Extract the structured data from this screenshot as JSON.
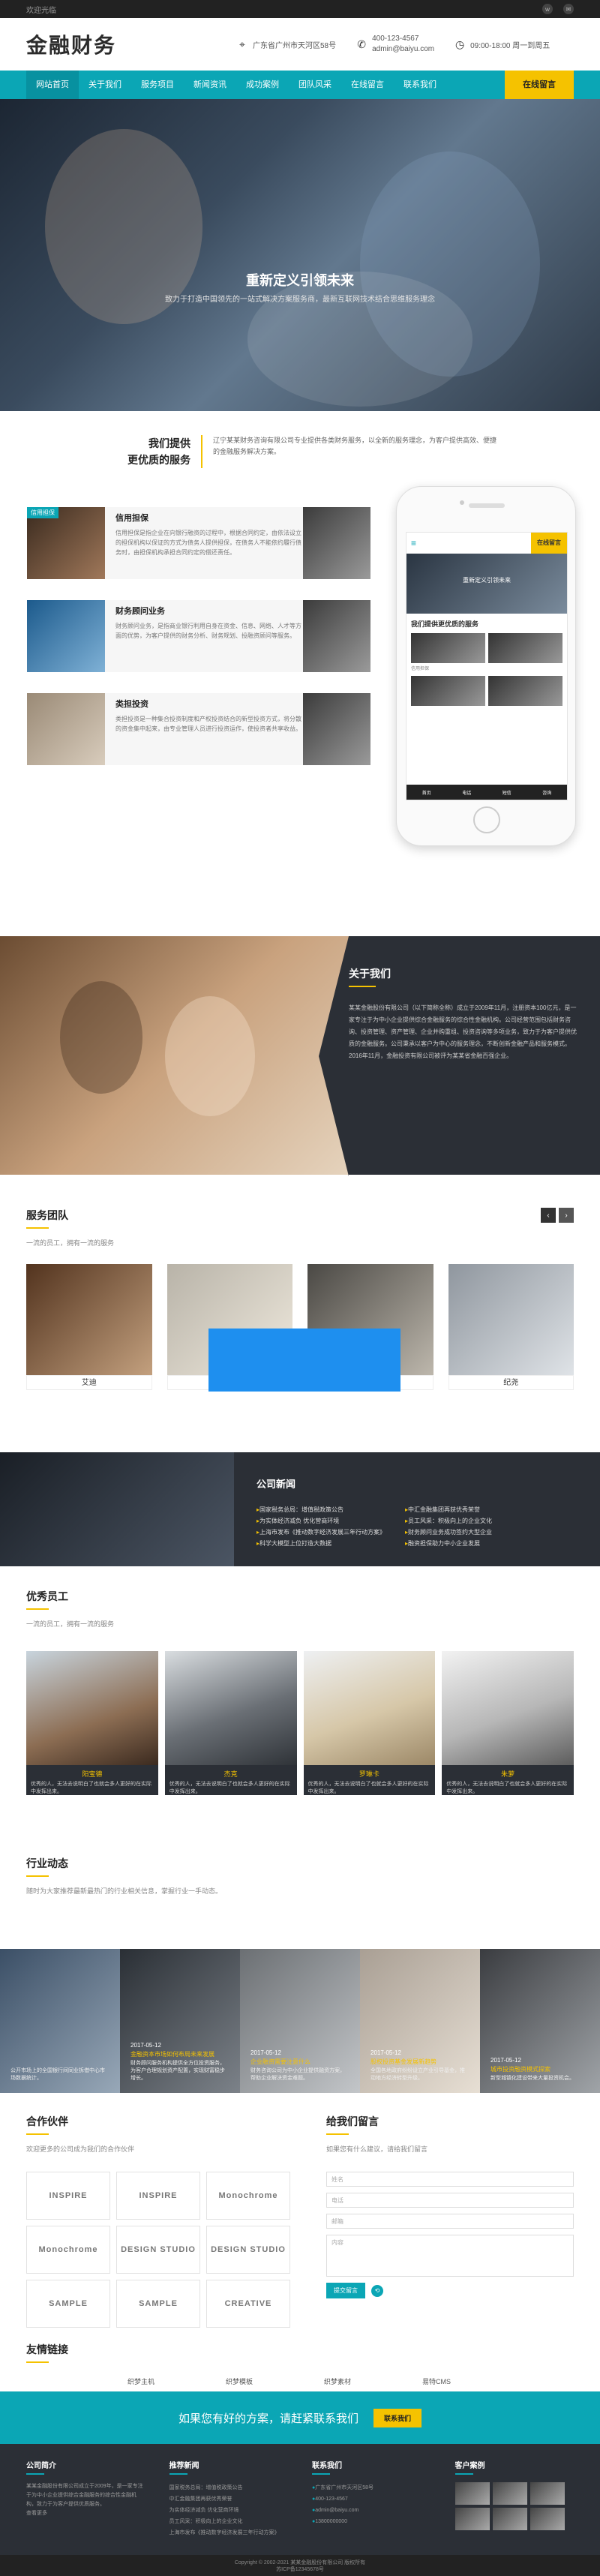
{
  "topbar": {
    "welcome": "欢迎光临"
  },
  "header": {
    "logo": "金融财务",
    "address": "广东省广州市天河区58号",
    "phone": "400-123-4567",
    "email": "admin@baiyu.com",
    "hours": "09:00-18:00 周一到周五"
  },
  "nav": {
    "items": [
      "网站首页",
      "关于我们",
      "服务项目",
      "新闻资讯",
      "成功案例",
      "团队风采",
      "在线留言",
      "联系我们"
    ],
    "cta": "在线留言"
  },
  "banner": {
    "title": "重新定义引领未来",
    "subtitle": "致力于打造中国领先的一站式解决方案服务商，最新互联网技术结合思维服务理念"
  },
  "services": {
    "intro_title_1": "我们提供",
    "intro_title_2": "更优质的服务",
    "intro_text": "辽宁某某财务咨询有限公司专业提供各类财务服务，以全新的服务理念，为客户提供高效、便捷的金融服务解决方案。",
    "items": [
      {
        "title": "信用担保",
        "text": "信用担保是指企业在向银行融资的过程中，根据合同约定，由依法设立的担保机构以保证的方式为债务人提供担保，在债务人不能依约履行债务时，由担保机构承担合同约定的偿还责任。"
      },
      {
        "title": "财务顾问业务",
        "text": "财务顾问业务，是指商业银行利用自身在资金、信息、网络、人才等方面的优势，为客户提供的财务分析、财务规划、投融资顾问等服务。"
      },
      {
        "title": "类担投资",
        "text": "类担投资是一种集合投资制度和产权投资结合的新型投资方式，将分散的资金集中起来，由专业管理人员进行投资运作，使投资者共享收益。"
      }
    ],
    "tag": "信用担保"
  },
  "phone": {
    "cta": "在线留言",
    "banner": "重新定义引领未来",
    "title": "我们提供更优质的服务",
    "tag": "信用担保",
    "nav": [
      "首页",
      "电话",
      "短信",
      "咨询"
    ]
  },
  "about": {
    "title": "关于我们",
    "text": "某某金融股份有限公司（以下简称全称）成立于2009年11月，注册资本100亿元，是一家专注于为中小企业提供综合金融服务的综合性金融机构。公司经营范围包括财务咨询、投资管理、资产管理、企业并购重组、投资咨询等多项业务，致力于为客户提供优质的金融服务。公司秉承以客户为中心的服务理念，不断创新金融产品和服务模式。2016年11月，金融投资有限公司被评为某某省金融百强企业。"
  },
  "team": {
    "title": "服务团队",
    "subtitle": "一流的员工，拥有一流的服务",
    "prev": "‹",
    "next": "›",
    "members": [
      "艾迪",
      "",
      "",
      "纪尧"
    ]
  },
  "news": {
    "title": "公司新闻",
    "col1": [
      "国家税务总局：增值税政策公告",
      "为实体经济减负 优化营商环境",
      "上海市发布《推动数字经济发展三年行动方案》",
      "科学大模型上位打造大数据"
    ],
    "col2": [
      "中汇金融集团再获优秀荣誉",
      "员工风采：积极向上的企业文化",
      "财务顾问业务成功签约大型企业",
      "融资担保助力中小企业发展"
    ]
  },
  "staff": {
    "title": "优秀员工",
    "subtitle": "一流的员工，拥有一流的服务",
    "members": [
      {
        "name": "阳宝德",
        "text": "优秀的人，无法去说明白了也就会多人更好的在实际中发挥出来。"
      },
      {
        "name": "杰克",
        "text": "优秀的人，无法去说明白了也就会多人更好的在实际中发挥出来。"
      },
      {
        "name": "罗琳卡",
        "text": "优秀的人，无法去说明白了也就会多人更好的在实际中发挥出来。"
      },
      {
        "name": "朱萝",
        "text": "优秀的人，无法去说明白了也就会多人更好的在实际中发挥出来。"
      }
    ]
  },
  "trend": {
    "title": "行业动态",
    "subtitle": "随时为大家推荐最新最热门的行业相关信息，掌握行业一手动态。",
    "items": [
      {
        "date": "",
        "title": "",
        "text": "公开市场上的全国银行间同业拆借中心市场数据统计。"
      },
      {
        "date": "2017-05-12",
        "title": "金融资本市场如何布局未来发展",
        "text": "财务顾问服务机构提供全方位投资服务，为客户合理规划资产配置，实现财富稳步增长。"
      },
      {
        "date": "2017-05-12",
        "title": "企业融资需要注意什么",
        "text": "财务咨询公司为中小企业提供融资方案，帮助企业解决资金难题。"
      },
      {
        "date": "2017-05-12",
        "title": "股权投资基金发展新趋势",
        "text": "全国各地政府纷纷设立产业引导基金，推动地方经济转型升级。"
      },
      {
        "date": "2017-05-12",
        "title": "城市投资融资模式探索",
        "text": "新型城镇化建设带来大量投资机会。"
      }
    ]
  },
  "partners": {
    "title": "合作伙伴",
    "subtitle": "欢迎更多的公司成为我们的合作伙伴",
    "logos": [
      "INSPIRE",
      "INSPIRE",
      "Monochrome",
      "Monochrome",
      "DESIGN STUDIO",
      "DESIGN STUDIO",
      "SAMPLE",
      "SAMPLE",
      "CREATIVE"
    ]
  },
  "message": {
    "title": "给我们留言",
    "subtitle": "如果您有什么建议，请给我们留言",
    "fields": [
      "姓名",
      "电话",
      "邮箱",
      "内容"
    ],
    "submit": "提交留言"
  },
  "links": {
    "title": "友情链接",
    "items": [
      "织梦主机",
      "织梦模板",
      "织梦素材",
      "易特CMS"
    ]
  },
  "cta": {
    "text": "如果您有好的方案，请赶紧联系我们",
    "button": "联系我们"
  },
  "footer": {
    "about_title": "公司简介",
    "about_text": "某某金融股份有限公司成立于2009年，是一家专注于为中小企业提供综合金融服务的综合性金融机构，致力于为客户提供优质服务。",
    "more": "查看更多",
    "news_title": "推荐新闻",
    "news": [
      "国家税务总局：增值税政策公告",
      "中汇金融集团再获优秀荣誉",
      "为实体经济减负 优化营商环境",
      "员工风采：积极向上的企业文化",
      "上海市发布《推动数字经济发展三年行动方案》"
    ],
    "contact_title": "联系我们",
    "contact": [
      "广东省广州市天河区58号",
      "400-123-4567",
      "admin@baiyu.com",
      "13800000000"
    ],
    "cases_title": "客户案例",
    "copyright": "Copyright © 2002-2021 某某金融股份有限公司 版权所有",
    "icp": "苏ICP备12345678号"
  }
}
